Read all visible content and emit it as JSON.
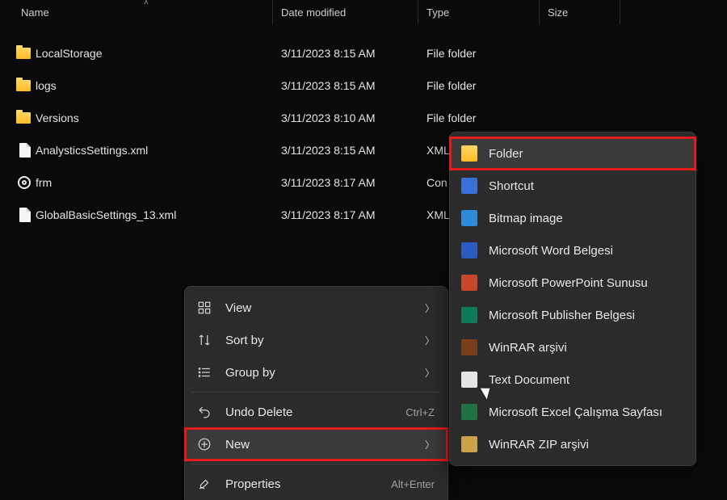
{
  "headers": {
    "name": "Name",
    "date": "Date modified",
    "type": "Type",
    "size": "Size"
  },
  "files": [
    {
      "icon": "folder",
      "name": "LocalStorage",
      "date": "3/11/2023 8:15 AM",
      "type": "File folder",
      "size": ""
    },
    {
      "icon": "folder",
      "name": "logs",
      "date": "3/11/2023 8:15 AM",
      "type": "File folder",
      "size": ""
    },
    {
      "icon": "folder",
      "name": "Versions",
      "date": "3/11/2023 8:10 AM",
      "type": "File folder",
      "size": ""
    },
    {
      "icon": "file",
      "name": "AnalysticsSettings.xml",
      "date": "3/11/2023 8:15 AM",
      "type": "XML",
      "size": ""
    },
    {
      "icon": "gear",
      "name": "frm",
      "date": "3/11/2023 8:17 AM",
      "type": "Con",
      "size": ""
    },
    {
      "icon": "file",
      "name": "GlobalBasicSettings_13.xml",
      "date": "3/11/2023 8:17 AM",
      "type": "XML",
      "size": ""
    }
  ],
  "context_menu": {
    "items": [
      {
        "icon": "view",
        "label": "View",
        "shortcut": "",
        "arrow": true
      },
      {
        "icon": "sort",
        "label": "Sort by",
        "shortcut": "",
        "arrow": true
      },
      {
        "icon": "group",
        "label": "Group by",
        "shortcut": "",
        "arrow": true
      },
      {
        "sep": true
      },
      {
        "icon": "undo",
        "label": "Undo Delete",
        "shortcut": "Ctrl+Z",
        "arrow": false
      },
      {
        "icon": "new",
        "label": "New",
        "shortcut": "",
        "arrow": true,
        "highlight": true,
        "hover": true
      },
      {
        "sep": true
      },
      {
        "icon": "props",
        "label": "Properties",
        "shortcut": "Alt+Enter",
        "arrow": false
      }
    ]
  },
  "new_submenu": {
    "items": [
      {
        "icon": "folder",
        "label": "Folder",
        "highlight": true,
        "hover": true
      },
      {
        "icon": "shortcut",
        "label": "Shortcut"
      },
      {
        "icon": "bmp",
        "label": "Bitmap image"
      },
      {
        "icon": "word",
        "label": "Microsoft Word Belgesi"
      },
      {
        "icon": "ppt",
        "label": "Microsoft PowerPoint Sunusu"
      },
      {
        "icon": "pub",
        "label": "Microsoft Publisher Belgesi"
      },
      {
        "icon": "rar",
        "label": "WinRAR arşivi"
      },
      {
        "icon": "txt",
        "label": "Text Document"
      },
      {
        "icon": "xls",
        "label": "Microsoft Excel Çalışma Sayfası"
      },
      {
        "icon": "zip",
        "label": "WinRAR ZIP arşivi"
      }
    ]
  }
}
